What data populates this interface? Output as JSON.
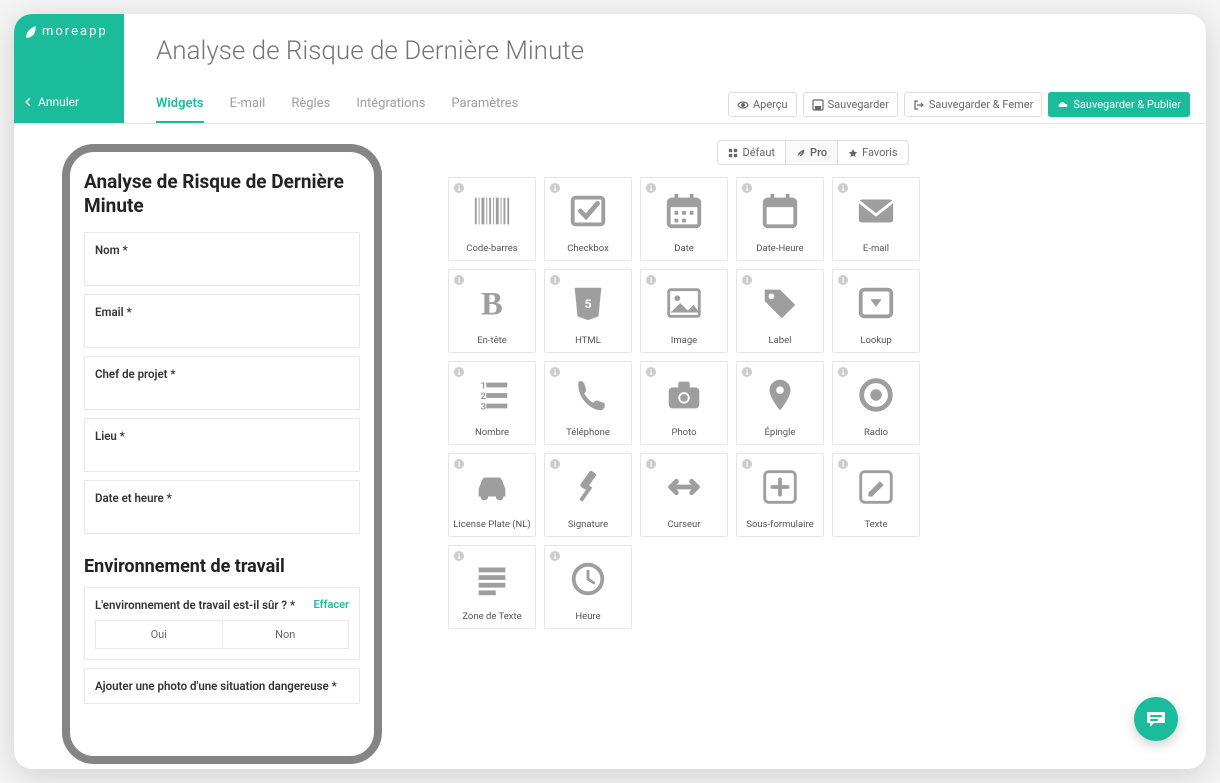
{
  "brand": "moreapp",
  "cancel_label": "Annuler",
  "page_title": "Analyse de Risque de Dernière Minute",
  "tabs": [
    {
      "label": "Widgets",
      "active": true
    },
    {
      "label": "E-mail",
      "active": false
    },
    {
      "label": "Règles",
      "active": false
    },
    {
      "label": "Intégrations",
      "active": false
    },
    {
      "label": "Paramètres",
      "active": false
    }
  ],
  "actions": {
    "preview": "Aperçu",
    "save": "Sauvegarder",
    "save_close": "Sauvegarder & Femer",
    "save_publish": "Sauvegarder & Publier"
  },
  "form": {
    "title": "Analyse de Risque de Dernière Minute",
    "fields": [
      {
        "label": "Nom *"
      },
      {
        "label": "Email *"
      },
      {
        "label": "Chef de projet *"
      },
      {
        "label": "Lieu *"
      },
      {
        "label": "Date et heure *"
      }
    ],
    "section_title": "Environnement de travail",
    "question": {
      "label": "L'environnement de travail est-il sûr ? *",
      "clear": "Effacer",
      "options": [
        "Oui",
        "Non"
      ]
    },
    "photo_label": "Ajouter une photo d'une situation dangereuse *"
  },
  "filters": [
    {
      "label": "Défaut",
      "icon": "dashboard-icon"
    },
    {
      "label": "Pro",
      "icon": "leaf-icon",
      "active": true
    },
    {
      "label": "Favoris",
      "icon": "star-icon"
    }
  ],
  "widgets": [
    {
      "label": "Code-barres",
      "icon": "barcode"
    },
    {
      "label": "Checkbox",
      "icon": "checkbox"
    },
    {
      "label": "Date",
      "icon": "calendar"
    },
    {
      "label": "Date-Heure",
      "icon": "calendar-clock"
    },
    {
      "label": "E-mail",
      "icon": "envelope"
    },
    {
      "label": "En-tête",
      "icon": "bold"
    },
    {
      "label": "HTML",
      "icon": "html5"
    },
    {
      "label": "Image",
      "icon": "image"
    },
    {
      "label": "Label",
      "icon": "tag"
    },
    {
      "label": "Lookup",
      "icon": "dropdown"
    },
    {
      "label": "Nombre",
      "icon": "numlist"
    },
    {
      "label": "Téléphone",
      "icon": "phone"
    },
    {
      "label": "Photo",
      "icon": "camera"
    },
    {
      "label": "Épingle",
      "icon": "pin"
    },
    {
      "label": "Radio",
      "icon": "radio"
    },
    {
      "label": "License Plate (NL)",
      "icon": "car"
    },
    {
      "label": "Signature",
      "icon": "gavel"
    },
    {
      "label": "Curseur",
      "icon": "slider"
    },
    {
      "label": "Sous-formulaire",
      "icon": "plus-square"
    },
    {
      "label": "Texte",
      "icon": "edit-square"
    },
    {
      "label": "Zone de Texte",
      "icon": "lines"
    },
    {
      "label": "Heure",
      "icon": "clock"
    }
  ]
}
